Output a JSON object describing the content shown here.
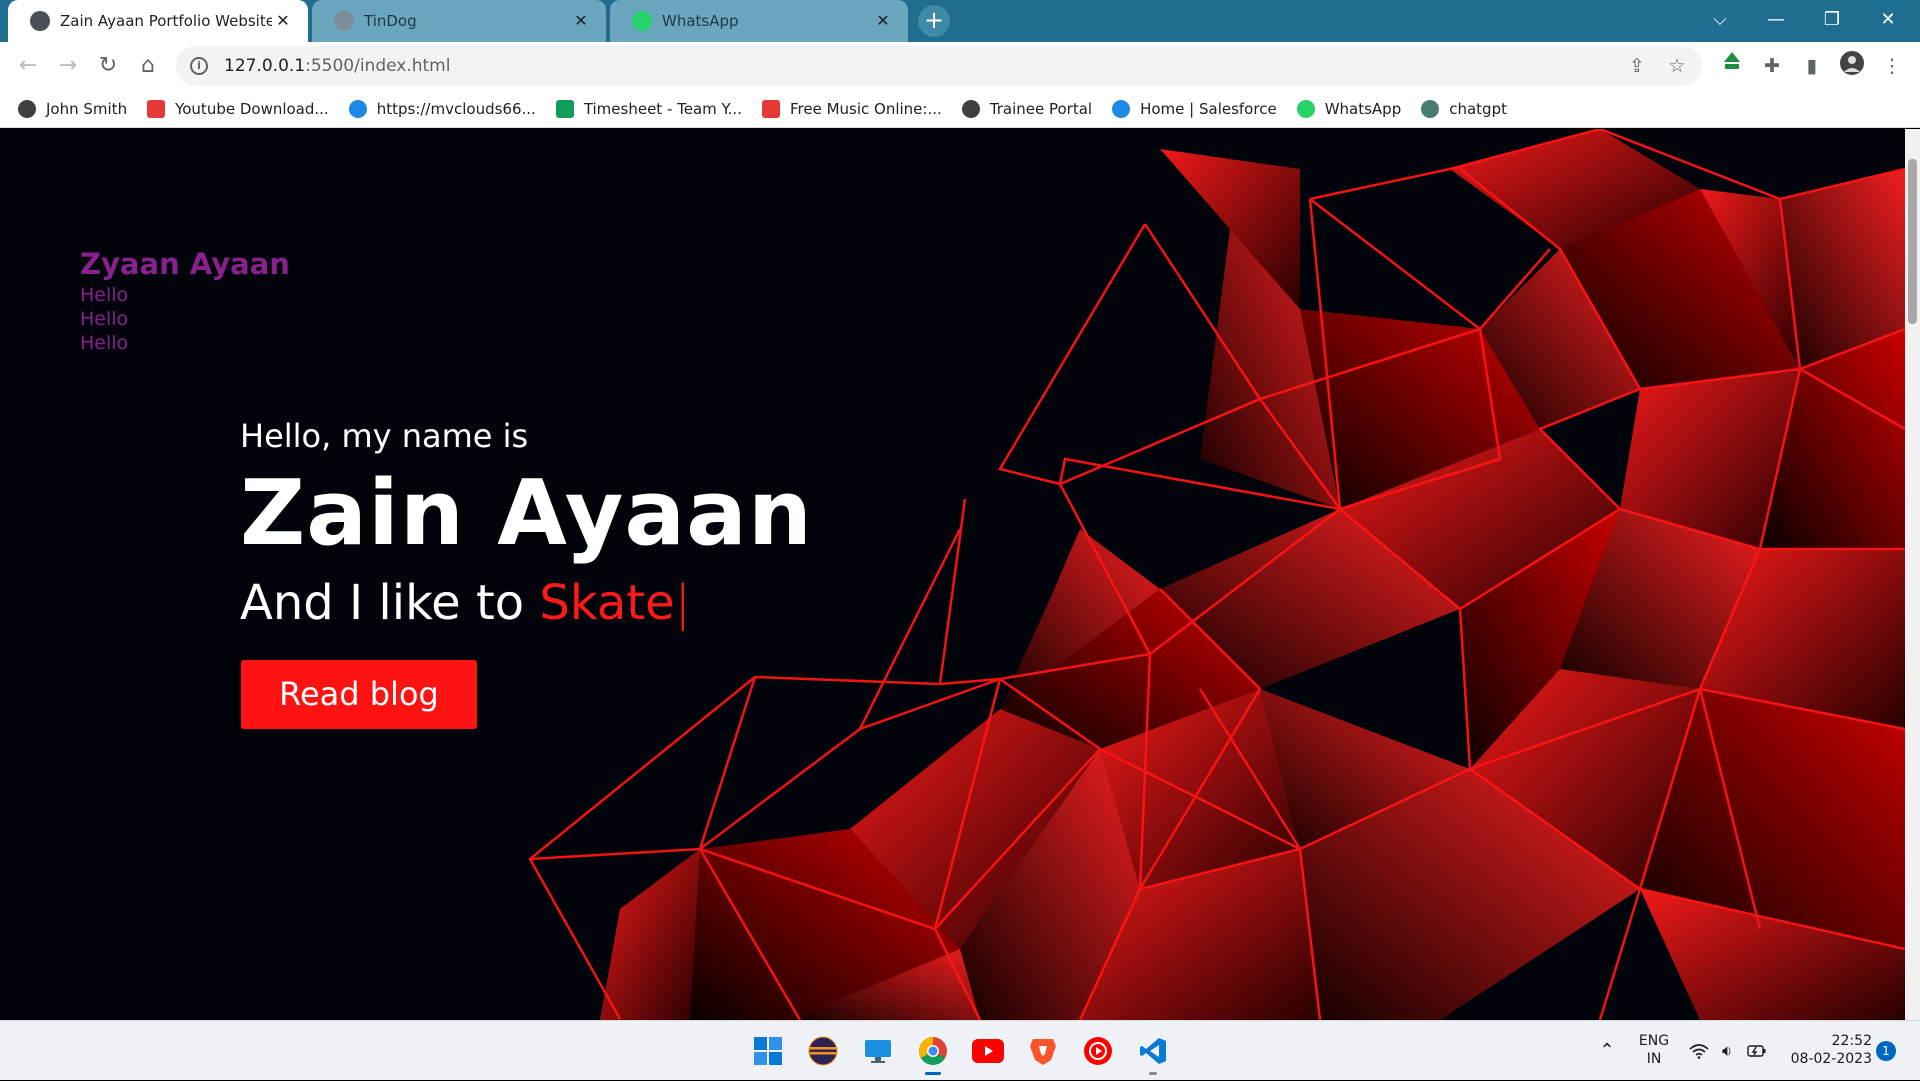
{
  "browser": {
    "tabs": [
      {
        "title": "Zain Ayaan Portfolio Website",
        "active": true
      },
      {
        "title": "TinDog",
        "active": false
      },
      {
        "title": "WhatsApp",
        "active": false
      }
    ],
    "new_tab": "+",
    "window_controls": {
      "dropdown": "⌵",
      "minimize": "—",
      "restore": "❐",
      "close": "✕"
    },
    "url": {
      "host": "127.0.0.1",
      "path": ":5500/index.html"
    },
    "bookmarks": [
      {
        "label": "John Smith",
        "icon": "globe-icon",
        "color": "#3c4043"
      },
      {
        "label": "Youtube Download...",
        "icon": "download-icon",
        "color": "#e53935"
      },
      {
        "label": "https://mvclouds66...",
        "icon": "cloud-icon",
        "color": "#1e88e5"
      },
      {
        "label": "Timesheet - Team Y...",
        "icon": "sheets-icon",
        "color": "#0f9d58"
      },
      {
        "label": "Free Music Online:...",
        "icon": "music-icon",
        "color": "#e53935"
      },
      {
        "label": "Trainee Portal",
        "icon": "globe-icon",
        "color": "#3c4043"
      },
      {
        "label": "Home | Salesforce",
        "icon": "cloud-icon",
        "color": "#1e88e5"
      },
      {
        "label": "WhatsApp",
        "icon": "whatsapp-icon",
        "color": "#25d366"
      },
      {
        "label": "chatgpt",
        "icon": "openai-icon",
        "color": "#4a7d72"
      }
    ]
  },
  "page": {
    "logo": "Zyaan Ayaan",
    "nav": [
      "Hello",
      "Hello",
      "Hello"
    ],
    "hero": {
      "greeting": "Hello, my name is",
      "name": "Zain Ayaan",
      "tagline_prefix": "And I like to",
      "tagline_word": "Skate",
      "cursor": "|",
      "button": "Read blog"
    },
    "colors": {
      "accent": "#ff1212",
      "logo": "#8a1f8e",
      "background": "#02040b"
    }
  },
  "taskbar": {
    "apps": [
      "windows-start-icon",
      "eclipse-icon",
      "desktop-icon",
      "chrome-icon",
      "youtube-icon",
      "brave-icon",
      "youtube-music-icon",
      "vscode-icon"
    ],
    "language": {
      "line1": "ENG",
      "line2": "IN"
    },
    "time": "22:52",
    "date": "08-02-2023",
    "notification_count": "1"
  }
}
